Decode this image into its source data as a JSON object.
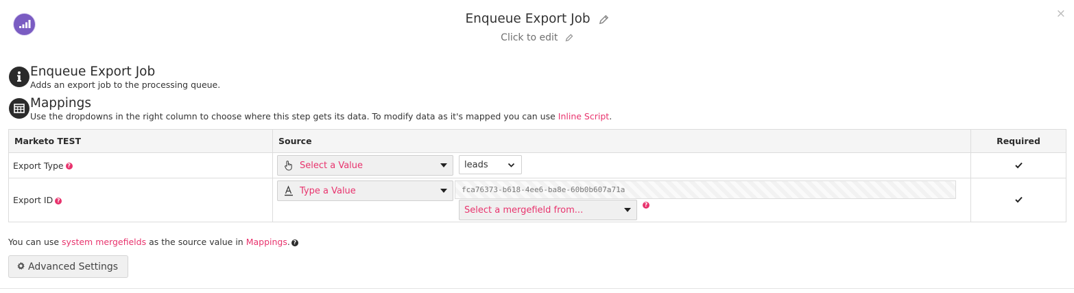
{
  "header": {
    "title": "Enqueue Export Job",
    "subtitle": "Click to edit",
    "close_glyph": "×",
    "logo_icon": "marketo-logo-icon",
    "edit_icon": "pencil-icon"
  },
  "info_section": {
    "icon": "info-icon",
    "title": "Enqueue Export Job",
    "description": "Adds an export job to the processing queue."
  },
  "mappings_section": {
    "icon": "table-icon",
    "title": "Mappings",
    "description_prefix": "Use the dropdowns in the right column to choose where this step gets its data. To modify data as it's mapped you can use ",
    "description_link": "Inline Script",
    "description_suffix": "."
  },
  "table": {
    "headers": [
      "Marketo TEST",
      "Source",
      "Required"
    ],
    "rows": [
      {
        "label": "Export Type",
        "source_mode": "Select a Value",
        "source_mode_icon": "hand-pointer-icon",
        "value": "leads",
        "required_icon": "checkmark-icon"
      },
      {
        "label": "Export ID",
        "source_mode": "Type a Value",
        "source_mode_icon": "text-format-icon",
        "value": "fca76373-b618-4ee6-ba8e-60b0b607a71a",
        "mergefield_placeholder": "Select a mergefield from...",
        "required_icon": "checkmark-icon"
      }
    ]
  },
  "footer": {
    "note_prefix": "You can use ",
    "note_link1": "system mergefields",
    "note_middle": " as the source value in ",
    "note_link2": "Mappings",
    "note_suffix": ".",
    "advanced_settings_label": "Advanced Settings",
    "advanced_icon": "gear-icon"
  },
  "colors": {
    "accent": "#e8336d",
    "logo": "#7a5cc2",
    "dark_icon": "#2b2b2b"
  }
}
